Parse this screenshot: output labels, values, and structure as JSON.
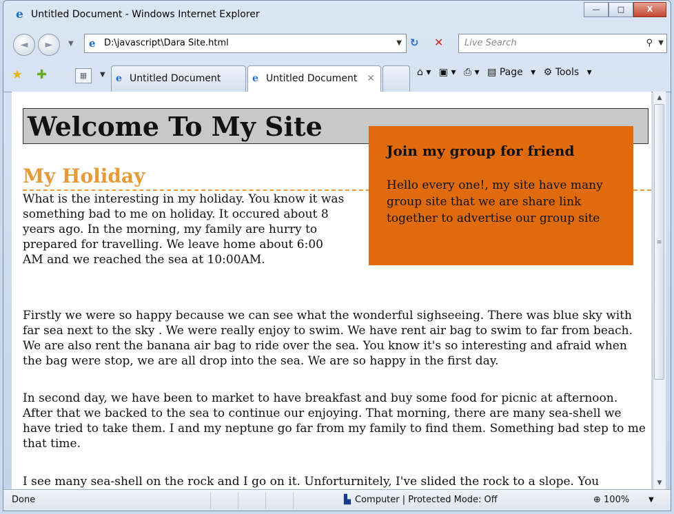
{
  "window": {
    "title": "Untitled Document - Windows Internet Explorer",
    "min_label": "—",
    "max_label": "□",
    "close_label": "X"
  },
  "nav": {
    "back_label": "◄",
    "forward_label": "►",
    "address": "D:\\javascript\\Dara Site.html",
    "search_placeholder": "Live Search"
  },
  "tabs": [
    {
      "label": "Untitled Document"
    },
    {
      "label": "Untitled Document"
    }
  ],
  "command_bar": {
    "page_label": "Page",
    "tools_label": "Tools"
  },
  "page": {
    "site_title": "Welcome To My Site",
    "section_heading": "My Holiday",
    "paragraphs": [
      "What is the interesting in my holiday. You know it was something bad to me on holiday. It occured about 8 years ago. In the morning, my family are hurry to prepared for travelling. We leave home about 6:00 AM and we reached the sea at 10:00AM.",
      "Firstly we were so happy because we can see what the wonderful sighseeing. There was blue sky with far sea next to the sky . We were really enjoy to swim. We have rent air bag to swim to far from beach. We are also rent the banana air bag to ride over the sea. You know it's so interesting and afraid when the bag were stop, we are all drop into the sea. We are so happy in the first day.",
      "In second day, we have been to market to have breakfast and buy some food for picnic at afternoon. After that we backed to the sea to continue our enjoying. That morning, there are many sea-shell we have tried to take them. I and my neptune go far from my family to find them. Something bad step to me that time.",
      "I see many sea-shell on the rock and I go on it. Unforturnitely, I've slided the rock to a slope. You"
    ],
    "sidebar_box": {
      "heading": "Join my group for friend",
      "text": "Hello every one!, my site have many group site that we are share link together to advertise our group site",
      "background": "#e06a0e"
    },
    "heading_color": "#e69a3a"
  },
  "status": {
    "text": "Done",
    "zone": "Computer | Protected Mode: Off",
    "zoom": "100%"
  }
}
